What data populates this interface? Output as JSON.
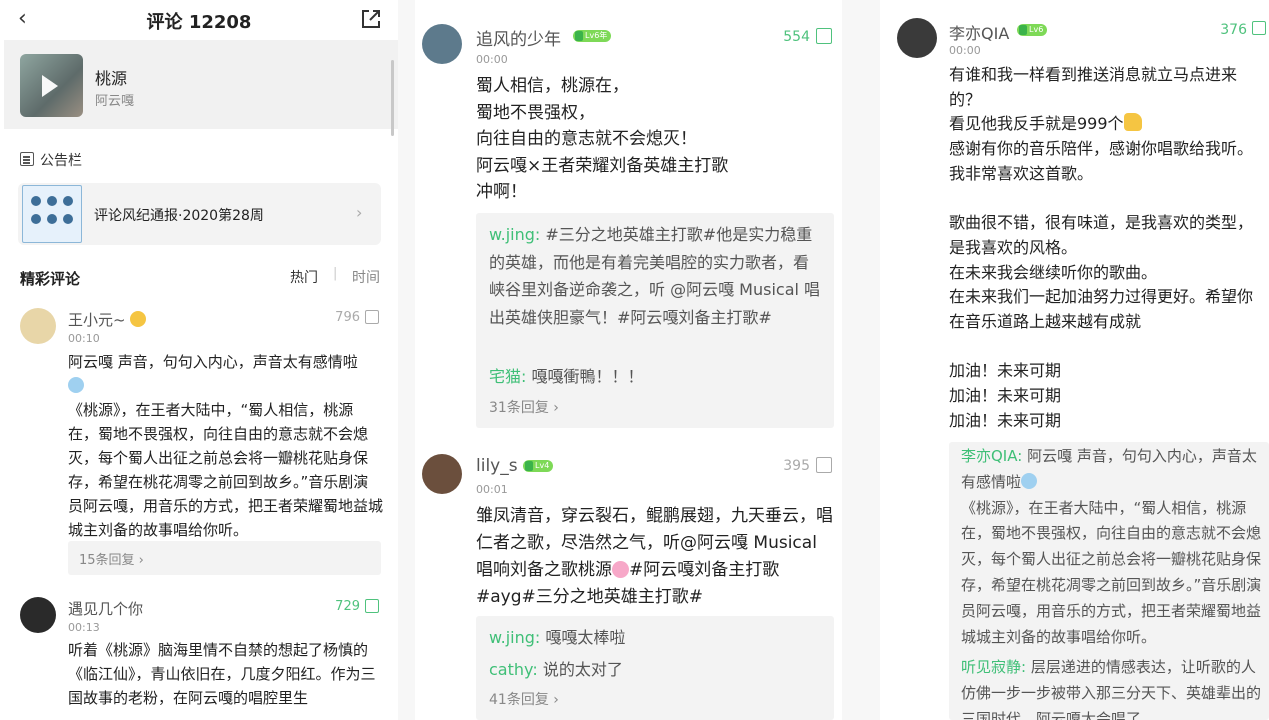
{
  "header": {
    "title": "评论 12208"
  },
  "song": {
    "name": "桃源",
    "artist": "阿云嘎"
  },
  "notice": {
    "label": "公告栏",
    "bulletin": "评论风纪通报·2020第28周"
  },
  "hot": {
    "title": "精彩评论",
    "sort_hot": "热门",
    "sort_sep": "|",
    "sort_time": "时间"
  },
  "comments_p1": [
    {
      "name": "王小元~",
      "time": "00:10",
      "likes": "796",
      "body_a": "阿云嘎 声音，句句入内心，声音太有感情啦",
      "body_b": "《桃源》，在王者大陆中，“蜀人相信，桃源在，蜀地不畏强权，向往自由的意志就不会熄灭，每个蜀人出征之前总会将一瓣桃花贴身保存，希望在桃花凋零之前回到故乡。”音乐剧演员阿云嘎，用音乐的方式，把王者荣耀蜀地益城城主刘备的故事唱给你听。",
      "replies": "15条回复"
    },
    {
      "name": "遇见几个你",
      "time": "00:13",
      "likes": "729",
      "body": "听着《桃源》脑海里情不自禁的想起了杨慎的《临江仙》，青山依旧在，几度夕阳红。作为三国故事的老粉，在阿云嘎的唱腔里生"
    }
  ],
  "comments_p2": [
    {
      "name": "追风的少年",
      "badge": "Lv6年",
      "time": "00:00",
      "likes": "554",
      "body": "蜀人相信，桃源在，\n蜀地不畏强权，\n向往自由的意志就不会熄灭！\n阿云嘎×王者荣耀刘备英雄主打歌\n冲啊！",
      "reply1_name": "w.jing:",
      "reply1_text": "#三分之地英雄主打歌#他是实力稳重的英雄，而他是有着完美唱腔的实力歌者，看峡谷里刘备逆命袭之，听 @阿云嘎 Musical 唱出英雄侠胆豪气！#阿云嘎刘备主打歌#",
      "reply2_name": "宅猫:",
      "reply2_text": "嘎嘎衝鴨！！！",
      "replies": "31条回复"
    },
    {
      "name": "lily_s",
      "badge": "Lv4",
      "time": "00:01",
      "likes": "395",
      "body_a": "雏凤清音，穿云裂石，鲲鹏展翅，九天垂云，唱仁者之歌，尽浩然之气，听@阿云嘎 Musical 唱响刘备之歌桃源",
      "body_b": "#阿云嘎刘备主打歌#ayg#三分之地英雄主打歌#",
      "reply1_name": "w.jing:",
      "reply1_text": "嘎嘎太棒啦",
      "reply2_name": "cathy:",
      "reply2_text": "说的太对了",
      "replies": "41条回复"
    }
  ],
  "comment_p3": {
    "name": "李亦QIA",
    "badge": "Lv6",
    "time": "00:00",
    "likes": "376",
    "body_a": "有谁和我一样看到推送消息就立马点进来的？\n看见他我反手就是999个",
    "body_b": "感谢有你的音乐陪伴，感谢你唱歌给我听。\n我非常喜欢这首歌。\n\n歌曲很不错，很有味道，是我喜欢的类型，是我喜欢的风格。\n在未来我会继续听你的歌曲。\n在未来我们一起加油努力过得更好。希望你在音乐道路上越来越有成就\n\n加油！未来可期\n加油！未来可期\n加油！未来可期",
    "reply1_name": "李亦QIA:",
    "reply1_text_a": "阿云嘎 声音，句句入内心，声音太有感情啦",
    "reply1_text_b": "《桃源》，在王者大陆中，“蜀人相信，桃源在，蜀地不畏强权，向往自由的意志就不会熄灭，每个蜀人出征之前总会将一瓣桃花贴身保存，希望在桃花凋零之前回到故乡。”音乐剧演员阿云嘎，用音乐的方式，把王者荣耀蜀地益城城主刘备的故事唱给你听。",
    "reply2_name": "听见寂静:",
    "reply2_text": "层层递进的情感表达，让听歌的人仿佛一步一步被带入那三分天下、英雄辈出的三国时代，阿云嘎太会唱了"
  },
  "colors": {
    "accent_green": "#4fc27d",
    "reply_name": "#3fbf77",
    "badge": "#7ed957"
  }
}
